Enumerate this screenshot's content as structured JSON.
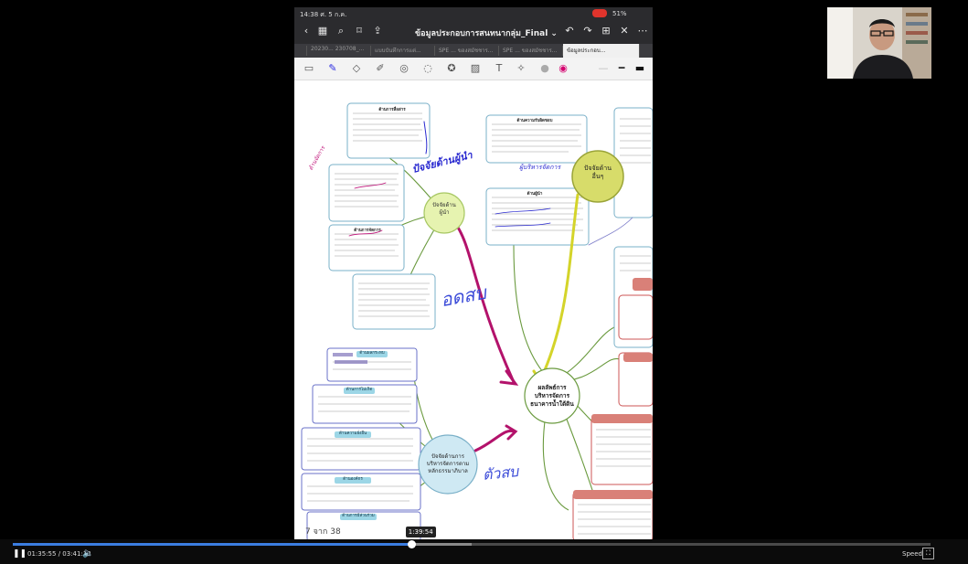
{
  "ipad": {
    "status": {
      "time": "14:38 ศ. 5 ก.ค.",
      "battery": "51%"
    },
    "doc_title": "ข้อมูลประกอบการสนทนากลุ่ม_Final ⌄",
    "tabs": [
      {
        "label": "",
        "active": false
      },
      {
        "label": "20230... 230708_...",
        "active": false
      },
      {
        "label": "แบบบันทึกการแต่...",
        "active": false
      },
      {
        "label": "SPE ... ของสมัชชาร...",
        "active": false
      },
      {
        "label": "SPE ... ของสมัชชาร...",
        "active": false
      },
      {
        "label": "ข้อมูลประกอบ...",
        "active": true
      }
    ],
    "page_label": "7 จาก 38",
    "mindmap": {
      "center": [
        "ผลลัพธ์การ",
        "บริหารจัดการ",
        "ธนาคารน้ำใต้ดิน"
      ],
      "node_top": [
        "ปัจจัยด้าน",
        "ผู้นำ"
      ],
      "node_right": [
        "ปัจจัยด้าน",
        "อื่นๆ"
      ],
      "node_bottom": [
        "ปัจจัยด้านการ",
        "บริหารจัดการตาม",
        "หลักธรรมาภิบาล"
      ],
      "box_headers": [
        "ด้านผลกระทบ",
        "ด้านการไม่เกิด",
        "ด้านความยั่งยืน",
        "ด้านองค์กร",
        "ด้านการมีส่วนร่วม",
        "ด้านความรับผิดชอบ",
        "ด้านผู้นำ",
        "ด้านการสื่อสาร",
        "ด้านการจัดการ"
      ],
      "annotations": {
        "top": "ปัจจัยด้านผู้นำ",
        "mid": "ผู้บริหารจัดการ",
        "left_arrow": "อดสบ",
        "bottom_arrow": "ตัวสบ",
        "side": "ด้านจัดการ"
      }
    }
  },
  "player": {
    "current_time": "01:35:55",
    "total_time": "03:41:12",
    "hover_time": "1:39:54",
    "progress": 0.434,
    "buffered": 0.5,
    "speed_label": "Speed"
  }
}
